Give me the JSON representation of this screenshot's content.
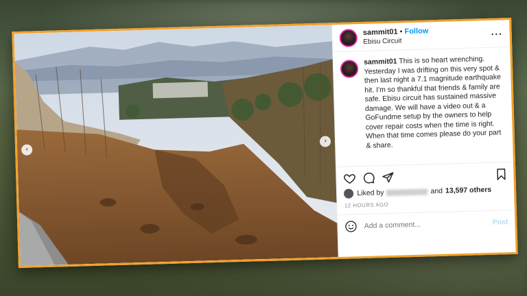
{
  "post": {
    "username": "sammit01",
    "separator": "•",
    "follow_label": "Follow",
    "location": "Ebisu Circuit",
    "more_icon": "more-options-icon",
    "caption_username": "sammit01",
    "caption_text": "This is so heart wrenching. Yesterday I was drifting on this very spot & then last night a 7.1 magnitude earthquake hit. I'm so thankful that friends & family are safe. Ebisu circuit has sustained massive damage. We will have a video out & a GoFundme setup by the owners to help cover repair costs when the time is right. When that time comes please do your part & share.",
    "liked_by_prefix": "Liked by",
    "liked_by_and": "and",
    "likes_count": "13,597 others",
    "timestamp": "12 HOURS AGO",
    "comment_placeholder": "Add a comment...",
    "post_label": "Post"
  },
  "icons": {
    "like": "heart-icon",
    "comment": "comment-icon",
    "share": "share-icon",
    "save": "bookmark-icon",
    "emoji": "emoji-icon",
    "carousel_prev": "chevron-left-icon",
    "carousel_next": "chevron-right-icon"
  },
  "colors": {
    "frame": "#f2a12a",
    "follow": "#0095f6",
    "post_disabled": "#b2dffc"
  }
}
